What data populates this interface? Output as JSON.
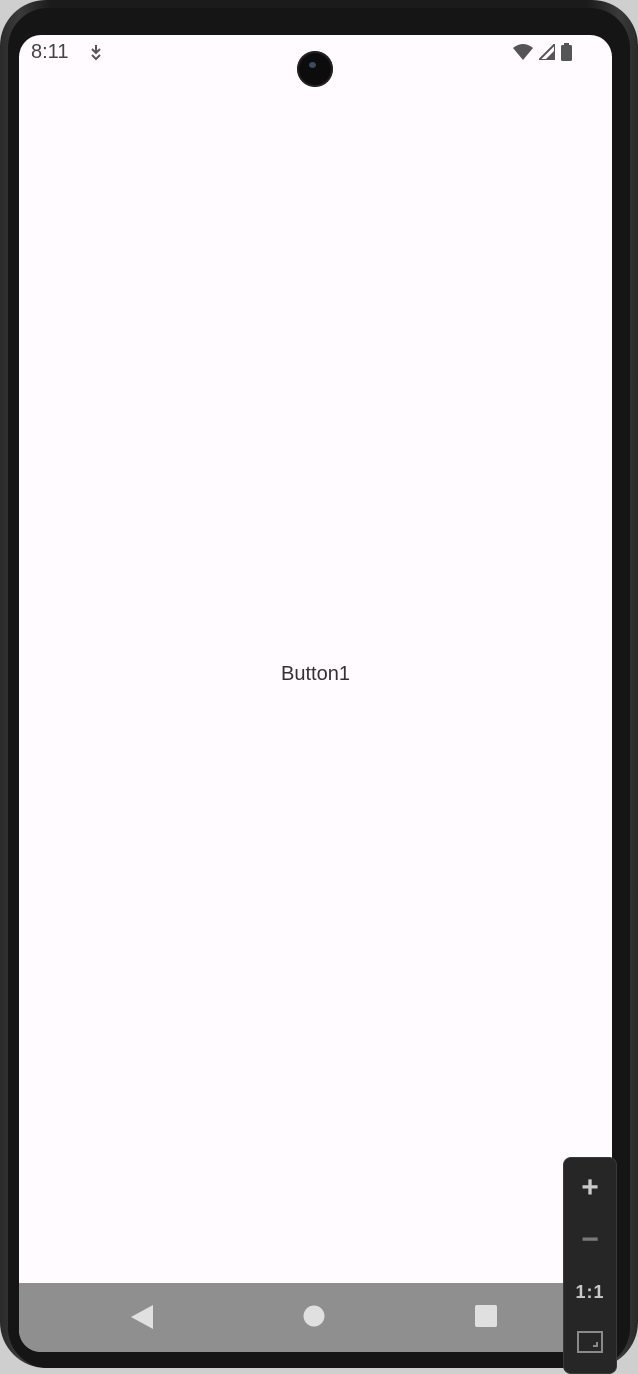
{
  "status_bar": {
    "time": "8:11",
    "notification_icon": "download-arrow-icon",
    "icons": [
      "wifi-icon",
      "cell-signal-icon",
      "battery-icon"
    ]
  },
  "app": {
    "button_label": "Button1"
  },
  "nav_bar": {
    "back": "back-triangle-icon",
    "home": "home-circle-icon",
    "recents": "recents-square-icon"
  },
  "zoom_controls": {
    "zoom_in": "+",
    "zoom_out": "−",
    "actual_size": "1:1",
    "fit": "fit-screen-icon"
  },
  "colors": {
    "screen_bg": "#fffbfe",
    "nav_bar_bg": "#8f8f8f",
    "device_frame": "#1b1b1b"
  }
}
